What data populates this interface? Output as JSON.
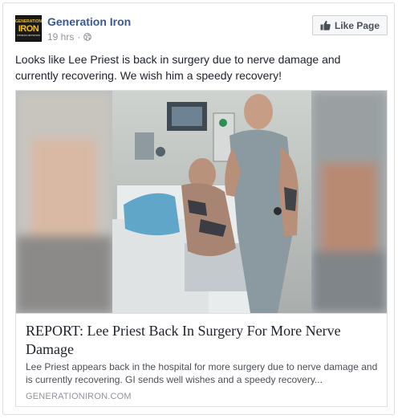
{
  "post": {
    "page_name": "Generation Iron",
    "logo": {
      "line1": "GENERATION",
      "line2": "IRON",
      "line3": "FITNESS NETWORK"
    },
    "timestamp": "19 hrs",
    "separator": "·",
    "privacy_icon": "globe-icon",
    "like_button_label": "Like Page",
    "like_icon": "thumbs-up-icon",
    "text": "Looks like Lee Priest is back in surgery due to nerve damage and currently recovering. We wish him a speedy recovery!"
  },
  "link": {
    "title": "REPORT: Lee Priest Back In Surgery For More Nerve Damage",
    "description": "Lee Priest appears back in the hospital for more surgery due to nerve damage and is currently recovering. GI sends well wishes and a speedy recovery...",
    "domain": "GENERATIONIRON.COM"
  },
  "colors": {
    "page_name": "#365899",
    "meta": "#90949c",
    "border": "#dddfe2",
    "button_bg": "#f6f7f9"
  }
}
